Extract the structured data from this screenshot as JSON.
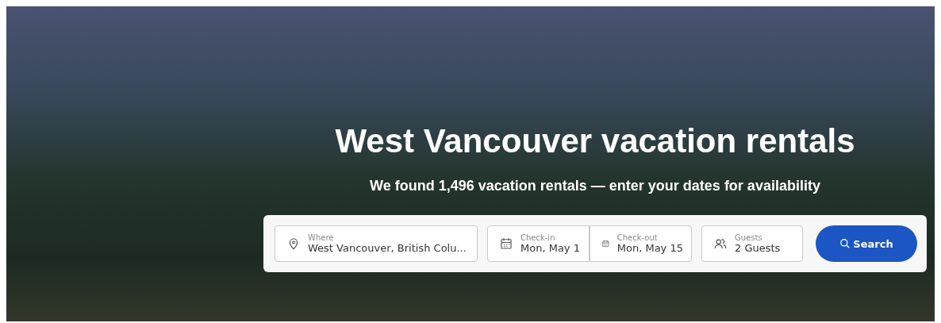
{
  "hero": {
    "title": "West Vancouver vacation rentals",
    "subtitle": "We found 1,496 vacation rentals — enter your dates for availability"
  },
  "search_bar": {
    "fields": [
      {
        "kind": "location",
        "label": "Where",
        "value": "West Vancouver, British Colu..."
      },
      {
        "kind": "date",
        "label": "Check-in",
        "value": "Mon, May 1"
      },
      {
        "kind": "date",
        "label": "Check-out",
        "value": "Mon, May 15"
      },
      {
        "kind": "guests",
        "label": "Guests",
        "value": "2 Guests"
      }
    ],
    "button": "Search"
  }
}
